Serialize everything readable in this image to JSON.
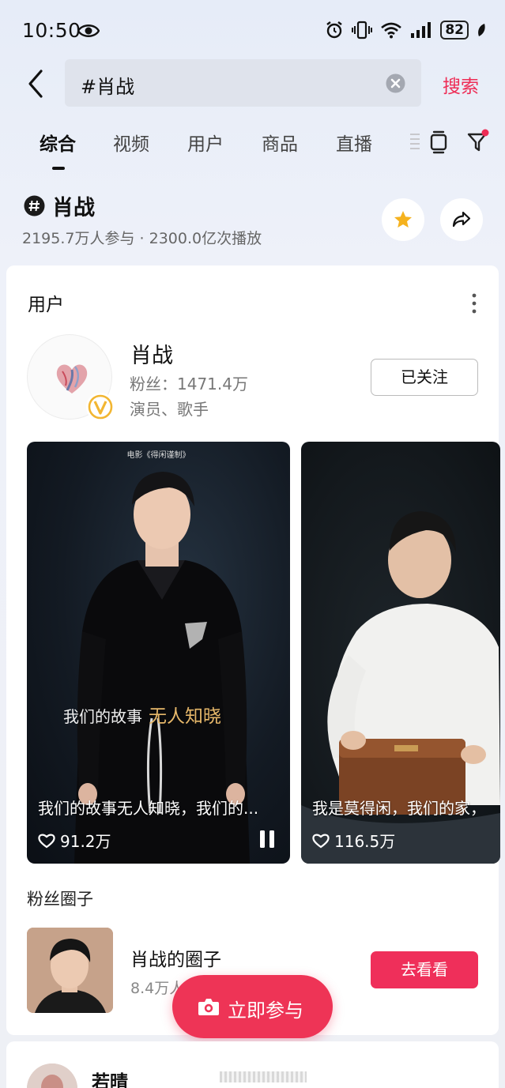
{
  "status_bar": {
    "time": "10:50",
    "battery": "82",
    "icons": [
      "eye-icon",
      "alarm-icon",
      "vibrate-icon",
      "wifi-icon",
      "signal-icon",
      "battery-icon",
      "leaf-icon"
    ]
  },
  "search": {
    "query": "#肖战",
    "button_label": "搜索"
  },
  "tabs": [
    {
      "label": "综合",
      "active": true
    },
    {
      "label": "视频",
      "active": false
    },
    {
      "label": "用户",
      "active": false
    },
    {
      "label": "商品",
      "active": false
    },
    {
      "label": "直播",
      "active": false
    }
  ],
  "topic": {
    "title": "肖战",
    "stats": "2195.7万人参与 · 2300.0亿次播放"
  },
  "user_section": {
    "title": "用户",
    "user": {
      "name": "肖战",
      "fans": "粉丝：1471.4万",
      "profession": "演员、歌手",
      "follow_label": "已关注"
    }
  },
  "videos": [
    {
      "film_caption": "电影《得闲谨制》",
      "overlay_text": "我们的故事",
      "overlay_accent": "无人知晓",
      "title": "我们的故事无人知晓，我们的...",
      "likes": "91.2万"
    },
    {
      "title": "我是莫得闲，我们的家，",
      "likes": "116.5万"
    }
  ],
  "fan_circle": {
    "title": "粉丝圈子",
    "name": "肖战的圈子",
    "count": "8.4万人",
    "button_label": "去看看"
  },
  "join_button": {
    "label": "立即参与"
  },
  "bottom_user": {
    "name": "若晴_"
  },
  "colors": {
    "accent": "#ee2c55",
    "badge_gold": "#f2b632"
  }
}
